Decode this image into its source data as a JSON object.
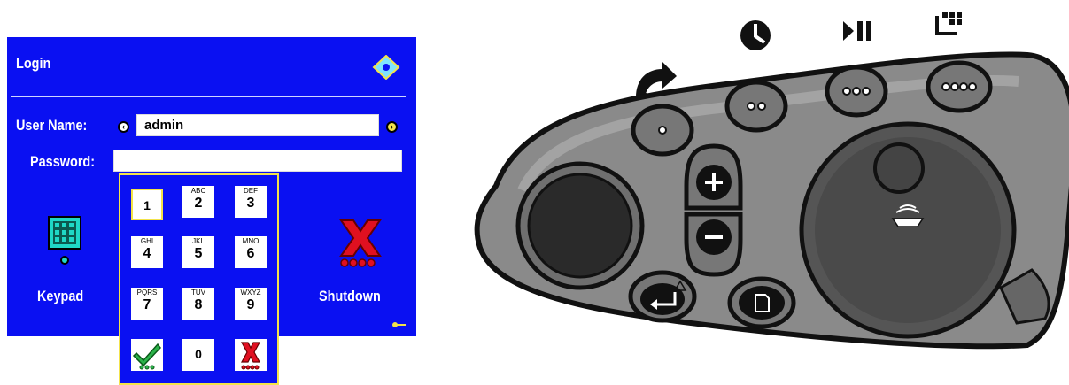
{
  "login": {
    "title": "Login",
    "username_label": "User Name:",
    "username_value": "admin",
    "password_label": "Password:",
    "password_value": "",
    "keypad_label": "Keypad",
    "shutdown_label": "Shutdown"
  },
  "keys": [
    {
      "sub": "",
      "num": "1"
    },
    {
      "sub": "ABC",
      "num": "2"
    },
    {
      "sub": "DEF",
      "num": "3"
    },
    {
      "sub": "GHI",
      "num": "4"
    },
    {
      "sub": "JKL",
      "num": "5"
    },
    {
      "sub": "MNO",
      "num": "6"
    },
    {
      "sub": "PQRS",
      "num": "7"
    },
    {
      "sub": "TUV",
      "num": "8"
    },
    {
      "sub": "WXYZ",
      "num": "9"
    },
    {
      "sub": "",
      "num": "0"
    }
  ],
  "colors": {
    "panel": "#0a10f2",
    "accent": "#f3e34a",
    "cancel": "#e01020",
    "ok": "#2bb34a",
    "device_body": "#8a8a8a"
  },
  "icons": {
    "top": [
      "redo-arrow-icon",
      "clock-icon",
      "play-pause-icon",
      "grid-stack-icon"
    ]
  }
}
